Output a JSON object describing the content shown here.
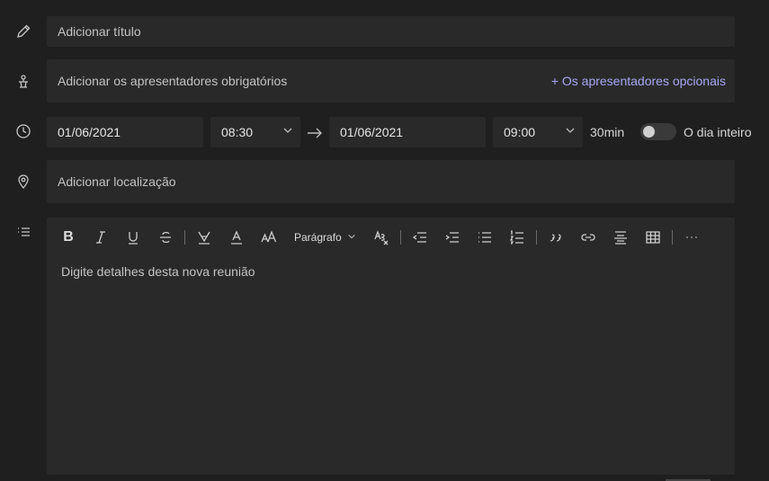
{
  "title_field": {
    "placeholder": "Adicionar título"
  },
  "presenters": {
    "placeholder": "Adicionar os apresentadores obrigatórios",
    "optional_link": "+ Os apresentadores opcionais"
  },
  "schedule": {
    "start_date": "01/06/2021",
    "start_time": "08:30",
    "end_date": "01/06/2021",
    "end_time": "09:00",
    "duration": "30min",
    "all_day_label": "O dia inteiro",
    "all_day_on": false
  },
  "location": {
    "placeholder": "Adicionar localização"
  },
  "editor": {
    "paragraph_label": "Parágrafo",
    "placeholder": "Digite detalhes desta nova reunião"
  },
  "colors": {
    "accent_link": "#a9a7f5",
    "background": "#1f1f1f",
    "field": "#292929"
  }
}
